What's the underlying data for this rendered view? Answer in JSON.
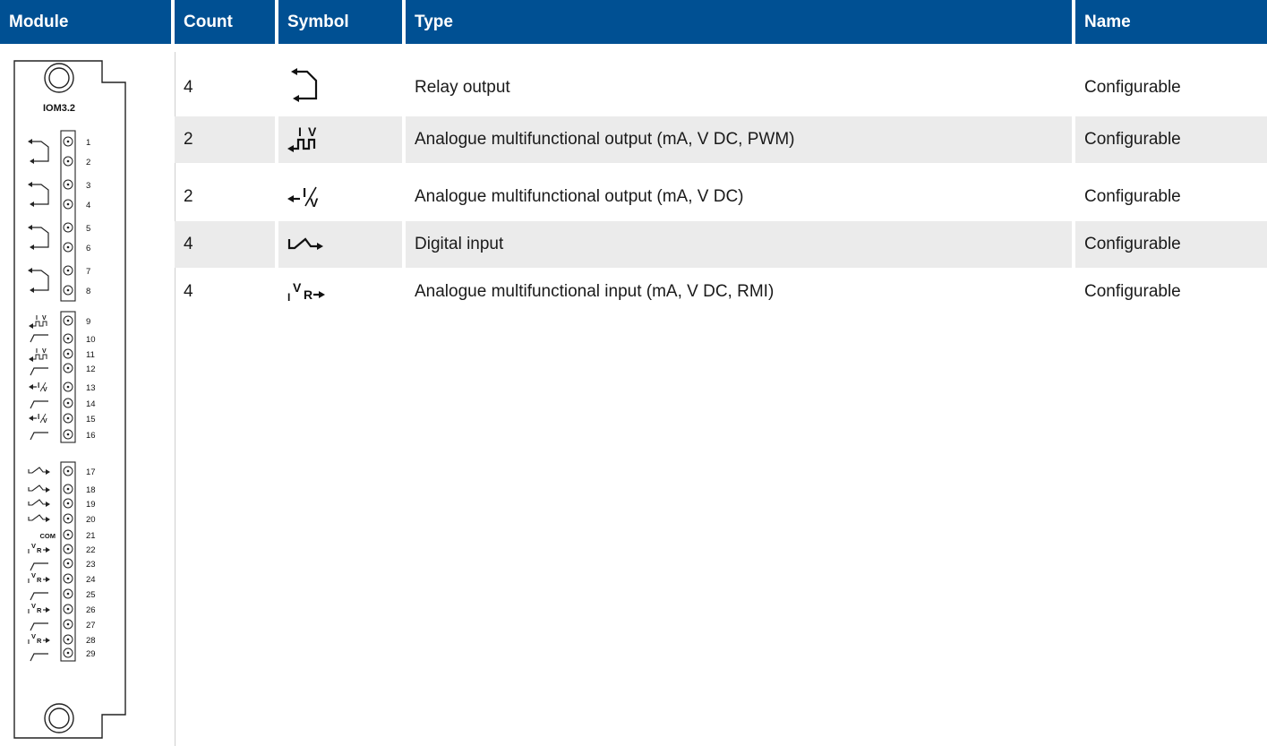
{
  "headers": {
    "module": "Module",
    "count": "Count",
    "symbol": "Symbol",
    "type": "Type",
    "name": "Name"
  },
  "rows": [
    {
      "count": "4",
      "symbol": "relay-output-icon",
      "type": "Relay output",
      "name": "Configurable"
    },
    {
      "count": "2",
      "symbol": "analogue-output-pwm-icon",
      "type": "Analogue multifunctional output (mA, V DC, PWM)",
      "name": "Configurable"
    },
    {
      "count": "2",
      "symbol": "analogue-output-icon",
      "type": "Analogue multifunctional output (mA, V DC)",
      "name": "Configurable"
    },
    {
      "count": "4",
      "symbol": "digital-input-icon",
      "type": "Digital input",
      "name": "Configurable"
    },
    {
      "count": "4",
      "symbol": "analogue-input-icon",
      "type": "Analogue multifunctional input (mA, V DC, RMI)",
      "name": "Configurable"
    }
  ],
  "module": {
    "label": "IOM3.2",
    "com_label": "COM",
    "terminals": [
      "1",
      "2",
      "3",
      "4",
      "5",
      "6",
      "7",
      "8",
      "9",
      "10",
      "11",
      "12",
      "13",
      "14",
      "15",
      "16",
      "17",
      "18",
      "19",
      "20",
      "21",
      "22",
      "23",
      "24",
      "25",
      "26",
      "27",
      "28",
      "29"
    ]
  },
  "symbol_text": {
    "i": "I",
    "v": "V",
    "r": "R"
  },
  "colors": {
    "header_bg": "#005093",
    "header_text": "#ffffff",
    "row_shade": "#ebebeb",
    "grid": "#d0d0d0"
  }
}
